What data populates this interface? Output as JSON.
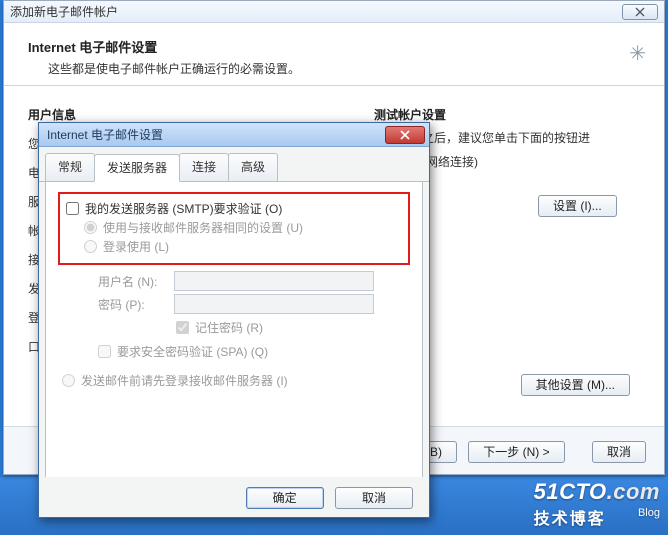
{
  "outer": {
    "title": "添加新电子邮件帐户",
    "header_title": "Internet 电子邮件设置",
    "header_sub": "这些都是使电子邮件帐户正确运行的必需设置。",
    "user_info_heading": "用户信息",
    "rows": [
      "您",
      "电",
      "服",
      "帐",
      "接",
      "发",
      "登",
      "口"
    ],
    "test_heading": "测试帐户设置",
    "test_text1": "这些信息之后，建议您单击下面的按钮进",
    "test_text2": "式。(需要网络连接)",
    "btn_account_settings": "设置 (I)...",
    "btn_other_settings": "其他设置 (M)...",
    "btn_back": "< 上一步 (B)",
    "btn_next": "下一步 (N) >",
    "btn_cancel": "取消"
  },
  "inner": {
    "title": "Internet 电子邮件设置",
    "tabs": {
      "general": "常规",
      "outgoing": "发送服务器",
      "connection": "连接",
      "advanced": "高级"
    },
    "chk_smtp_auth": "我的发送服务器 (SMTP)要求验证 (O)",
    "rad_same": "使用与接收邮件服务器相同的设置 (U)",
    "rad_login": "登录使用 (L)",
    "lbl_user": "用户名 (N):",
    "lbl_pass": "密码 (P):",
    "chk_remember": "记住密码 (R)",
    "chk_spa": "要求安全密码验证 (SPA) (Q)",
    "rad_pop_first": "发送邮件前请先登录接收邮件服务器 (I)",
    "btn_ok": "确定",
    "btn_cancel": "取消"
  },
  "watermark": {
    "brand": "51CTO",
    "ext": ".com",
    "sub": "技术博客",
    "blog": "Blog"
  }
}
